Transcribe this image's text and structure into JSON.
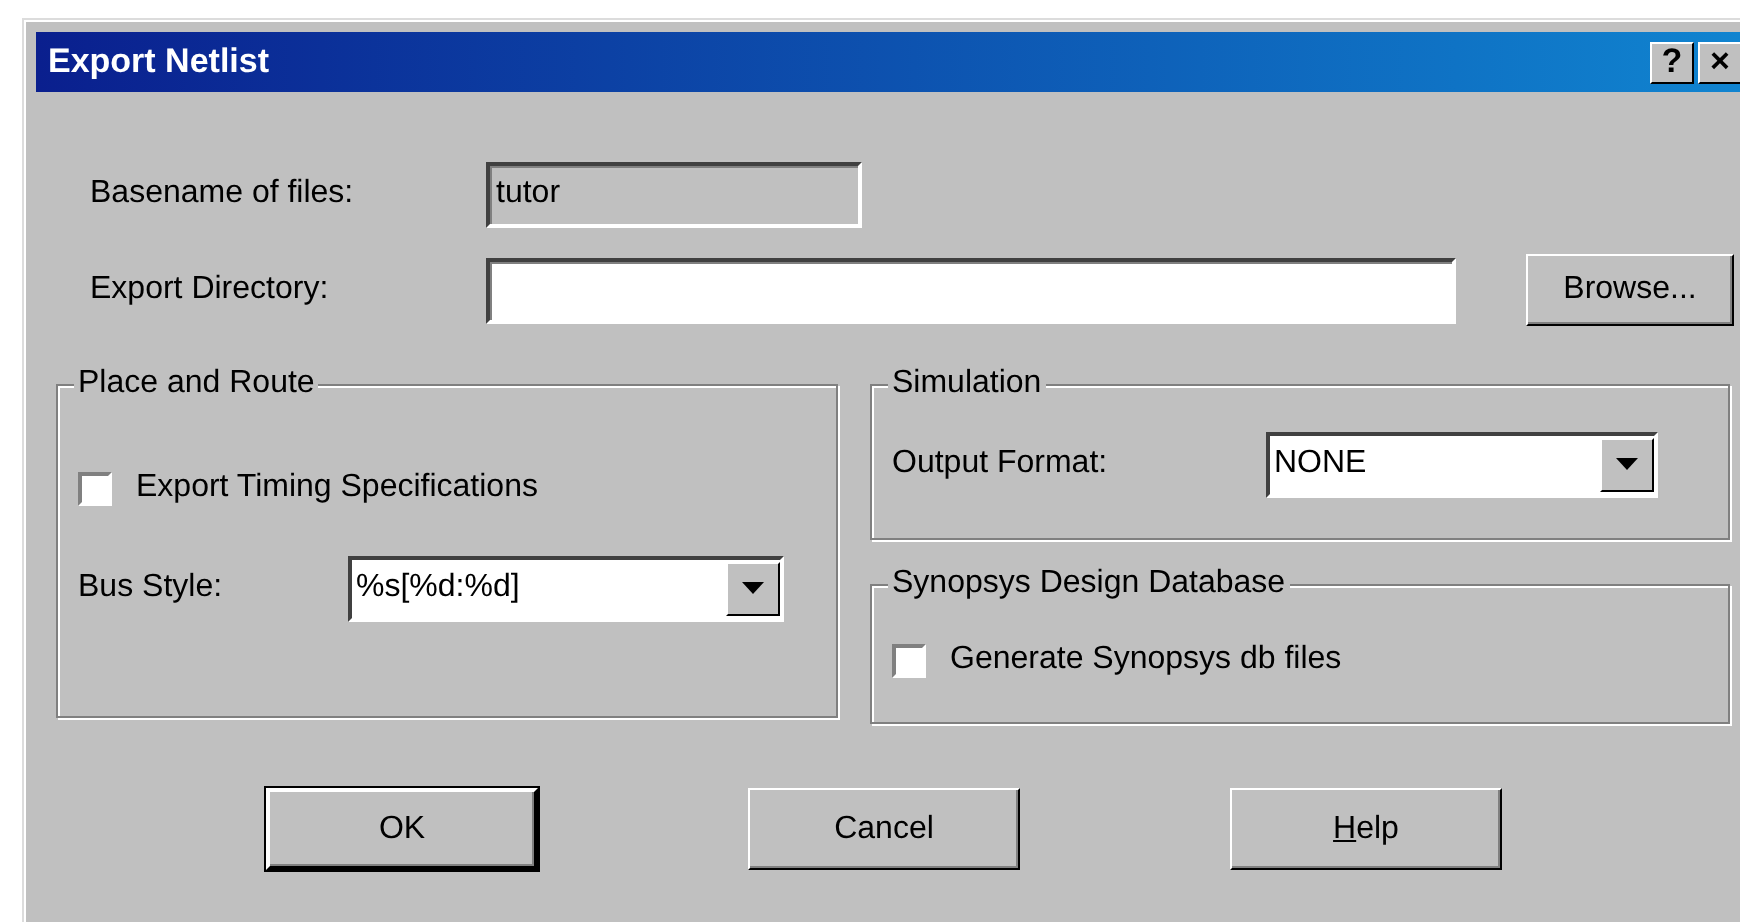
{
  "window": {
    "title": "Export Netlist",
    "title_buttons": [
      "?",
      "×"
    ]
  },
  "fields": [
    {
      "label": "Basename of files:",
      "value": "tutor",
      "disabled": true
    },
    {
      "label": "Export Directory:",
      "disabled": false
    }
  ],
  "browse_button": "Browse...",
  "place_and_route": {
    "title": "Place and Route",
    "checkbox": {
      "label": "Export Timing Specifications",
      "checked": false
    },
    "bus_style": {
      "label": "Bus Style:",
      "value": "%s[%d:%d]"
    }
  },
  "simulation": {
    "title": "Simulation",
    "output_format": {
      "label": "Output Format:",
      "value": "NONE"
    }
  },
  "synopsys": {
    "title": "Synopsys Design Database",
    "checkbox": {
      "label": "Generate Synopsys db files",
      "checked": false
    }
  },
  "buttons": [
    {
      "parts": [
        {
          "text": "OK",
          "underlined": false
        }
      ],
      "default": true
    },
    {
      "parts": [
        {
          "text": "Cancel",
          "underlined": false
        }
      ],
      "default": false
    },
    {
      "parts": [
        {
          "text": "H",
          "underlined": true
        },
        {
          "text": "elp",
          "underlined": false
        }
      ],
      "default": false
    }
  ]
}
